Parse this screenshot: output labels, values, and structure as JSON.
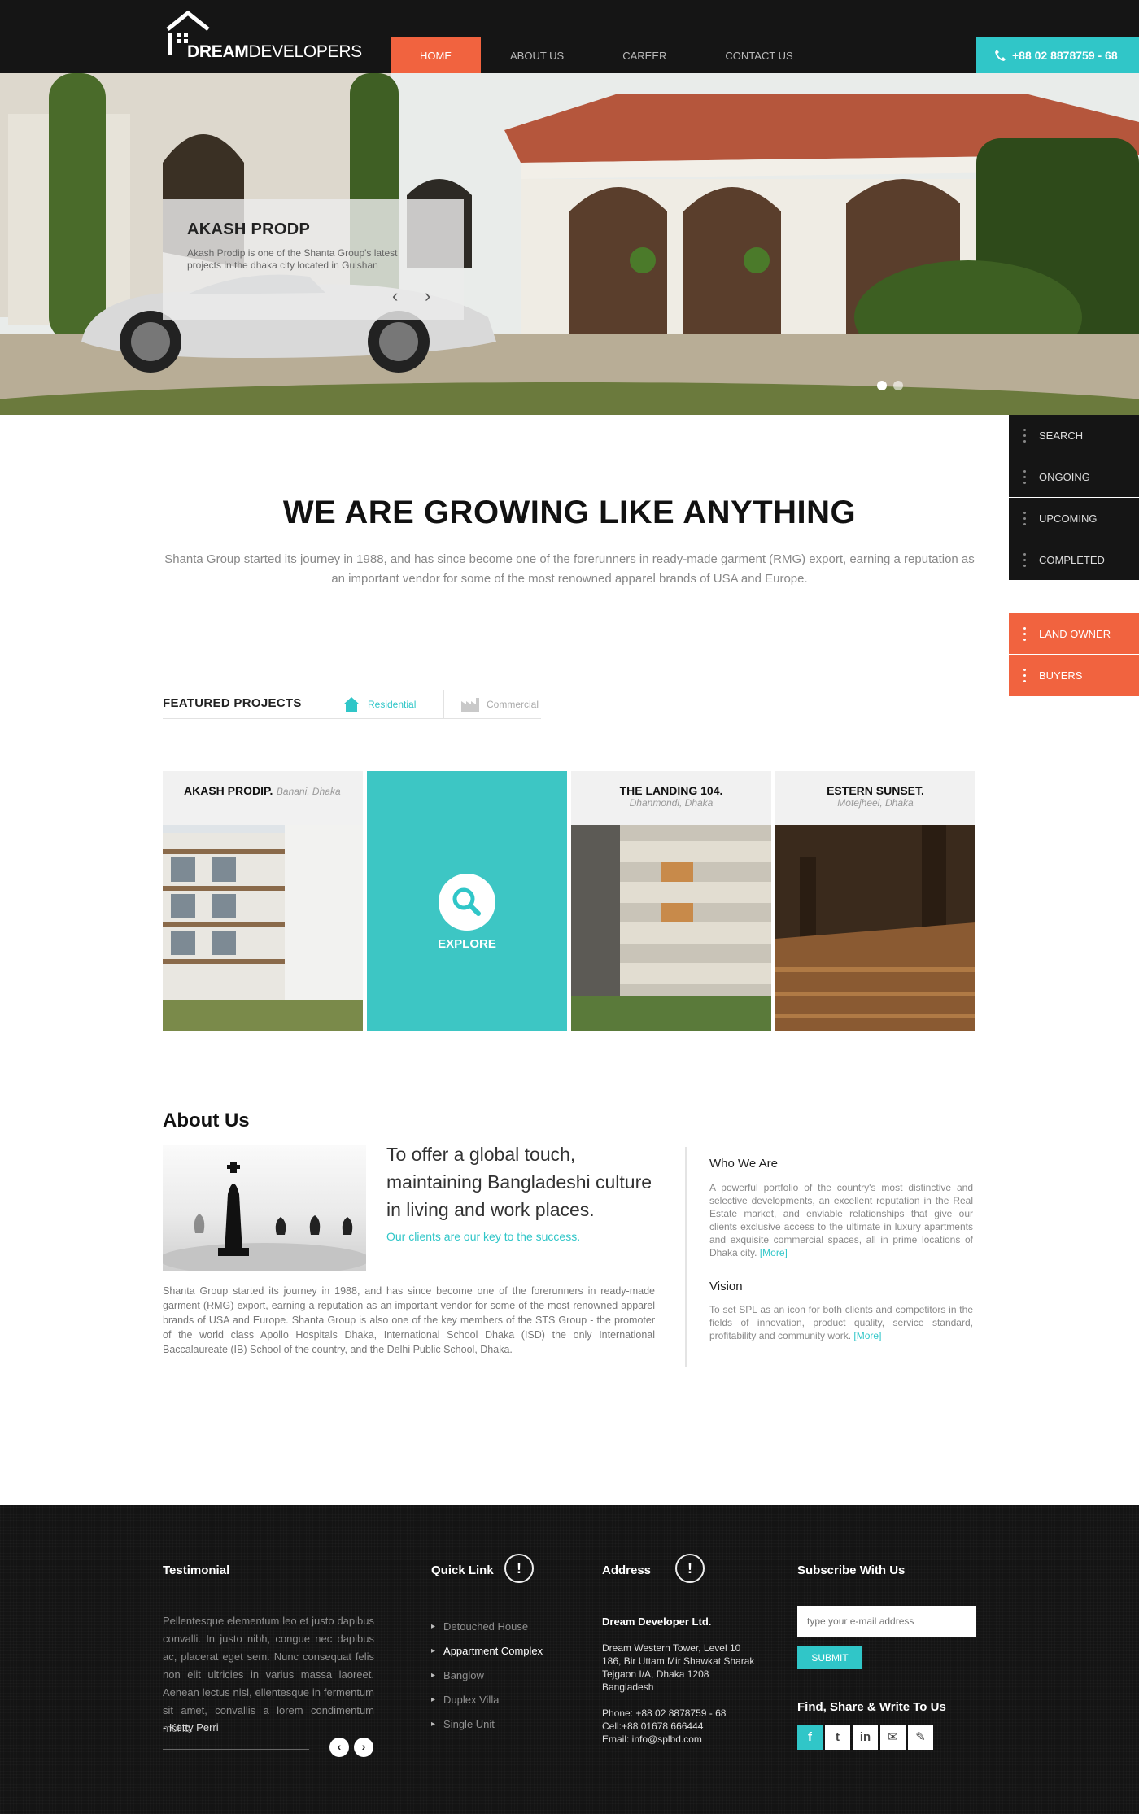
{
  "header": {
    "logo_bold": "DREAM",
    "logo_light": "DEVELOPERS",
    "nav": [
      "HOME",
      "ABOUT US",
      "CAREER",
      "CONTACT US"
    ],
    "active_nav": "HOME",
    "phone": "+88 02 8878759 - 68"
  },
  "hero": {
    "title": "AKASH PRODP",
    "description": "Akash Prodip is one of the Shanta Group's latest projects in the dhaka city located in Gulshan",
    "prev_icon": "chevron-left-icon",
    "next_icon": "chevron-right-icon",
    "dots": 2,
    "active_dot": 1
  },
  "side_menu": {
    "items": [
      "SEARCH",
      "ONGOING",
      "UPCOMING",
      "COMPLETED"
    ],
    "accent_items": [
      "LAND OWNER",
      "BUYERS"
    ]
  },
  "intro": {
    "title": "WE ARE GROWING LIKE ANYTHING",
    "text": "Shanta Group started its journey in 1988, and has since become one of the forerunners in ready-made garment (RMG) export, earning a reputation as an important vendor for some of the most renowned apparel brands of USA and Europe."
  },
  "featured": {
    "title": "FEATURED PROJECTS",
    "tabs": [
      "Residential",
      "Commercial"
    ],
    "active_tab": "Residential",
    "projects": [
      {
        "name": "AKASH PRODIP.",
        "location": "Banani, Dhaka"
      },
      {
        "name": "THE LANDING 104.",
        "location": "Dhanmondi, Dhaka"
      },
      {
        "name": "ESTERN SUNSET.",
        "location": "Motejheel, Dhaka"
      }
    ],
    "explore_label": "EXPLORE"
  },
  "about": {
    "title": "About Us",
    "lead": "To offer a global touch, maintaining Bangladeshi culture in living and work places.",
    "tagline": "Our clients are our key to the success.",
    "text": "Shanta Group started its journey in 1988, and has since become one of the forerunners in ready-made garment (RMG) export, earning a reputation as an important vendor for some of the most renowned apparel brands of USA and Europe. Shanta Group is also one of the key members of the STS Group - the promoter of the world class Apollo Hospitals Dhaka, International School Dhaka (ISD) the only International Baccalaureate (IB) School of the country, and the Delhi Public School, Dhaka.",
    "who_title": "Who We Are",
    "who_text": "A powerful portfolio of the country's most distinctive and selective developments, an excellent reputation in the Real Estate market, and enviable relationships that give our clients exclusive access to the ultimate in luxury apartments and exquisite commercial spaces, all in prime locations of Dhaka city.",
    "vision_title": "Vision",
    "vision_text": "To set SPL as an icon for both clients and competitors in the fields of innovation, product quality, service standard, profitability and community work.",
    "more_label": "[More]"
  },
  "footer": {
    "testimonial_title": "Testimonial",
    "testimonial_text": "Pellentesque elementum leo et justo dapibus convalli. In justo nibh, congue nec dapibus ac, placerat eget sem. Nunc consequat felis non elit ultricies in varius massa laoreet. Aenean lectus nisl, ellentesque in fermentum sit amet, convallis a lorem condimentum mollis.",
    "testimonial_author": "- Ketty Perri",
    "quicklink_title": "Quick Link",
    "quicklinks": [
      "Detouched House",
      "Appartment Complex",
      "Banglow",
      "Duplex Villa",
      "Single Unit"
    ],
    "active_quicklink": "Appartment Complex",
    "address_title": "Address",
    "company": "Dream Developer Ltd.",
    "address_lines": [
      "Dream Western Tower, Level 10",
      "186, Bir Uttam Mir Shawkat Sharak",
      "Tejgaon I/A, Dhaka 1208",
      "Bangladesh"
    ],
    "phone": "Phone: +88 02 8878759 - 68",
    "cell": "Cell:+88 01678 666444",
    "email": "Email: info@splbd.com",
    "subscribe_title": "Subscribe With Us",
    "subscribe_placeholder": "type your e-mail address",
    "subscribe_button": "SUBMIT",
    "social_title": "Find, Share & Write To Us",
    "social": [
      "f",
      "t",
      "in"
    ]
  },
  "colors": {
    "accent_orange": "#f1633f",
    "accent_teal": "#30c6c8",
    "dark": "#151515"
  }
}
